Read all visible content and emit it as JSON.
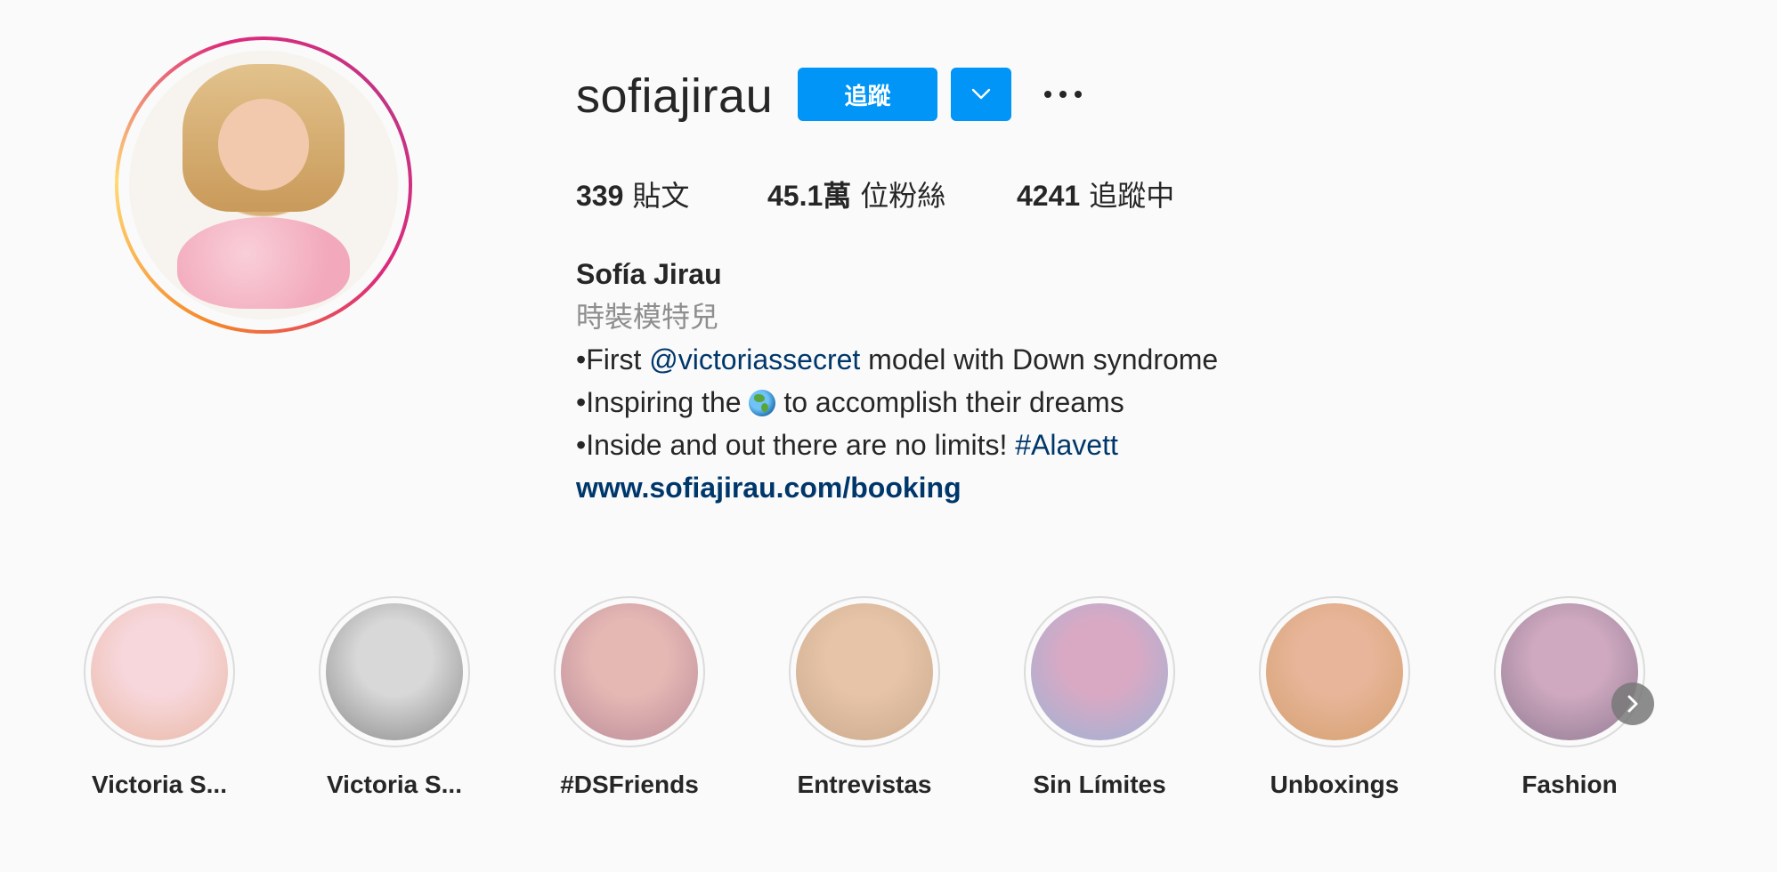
{
  "profile": {
    "username": "sofiajirau",
    "follow_label": "追蹤",
    "stats": {
      "posts_count": "339",
      "posts_label": "貼文",
      "followers_count": "45.1萬",
      "followers_label": "位粉絲",
      "following_count": "4241",
      "following_label": "追蹤中"
    },
    "bio": {
      "full_name": "Sofía Jirau",
      "category": "時裝模特兒",
      "line1_prefix": "•First ",
      "line1_mention": "@victoriassecret",
      "line1_suffix": " model with Down syndrome",
      "line2_prefix": "•Inspiring the ",
      "line2_emoji_icon": "globe-emoji-icon",
      "line2_suffix": " to accomplish their dreams",
      "line3_prefix": "•Inside and out there are no limits! ",
      "line3_hashtag": "#Alavett",
      "website": "www.sofiajirau.com/booking"
    }
  },
  "highlights": [
    {
      "label": "Victoria S...",
      "color_a": "#f7d7dc",
      "color_b": "#e9b8a4"
    },
    {
      "label": "Victoria S...",
      "color_a": "#d8d8d8",
      "color_b": "#8a8a8a"
    },
    {
      "label": "#DSFriends",
      "color_a": "#e6b8b4",
      "color_b": "#b98c9a"
    },
    {
      "label": "Entrevistas",
      "color_a": "#e7c4a8",
      "color_b": "#c9a98c"
    },
    {
      "label": "Sin Límites",
      "color_a": "#d9a9c4",
      "color_b": "#9bb3d6"
    },
    {
      "label": "Unboxings",
      "color_a": "#e8b59a",
      "color_b": "#d3a06e"
    },
    {
      "label": "Fashion",
      "color_a": "#cfa9bf",
      "color_b": "#8f7a93"
    }
  ],
  "colors": {
    "accent": "#0095f6",
    "link": "#00376b",
    "secondary_text": "#8e8e8e"
  }
}
